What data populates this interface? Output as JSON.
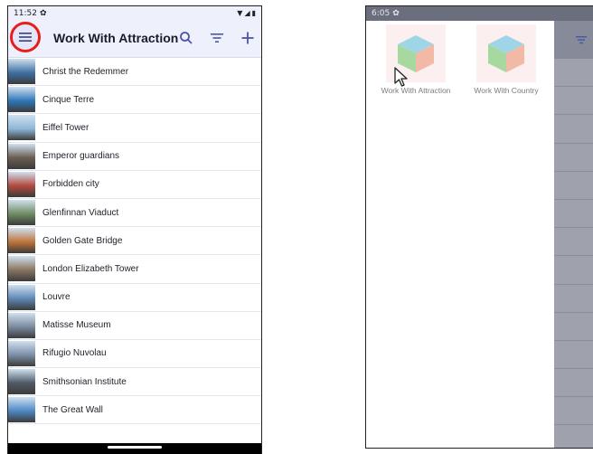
{
  "left": {
    "status": {
      "time": "11:52"
    },
    "appbar": {
      "title": "Work With Attraction"
    },
    "items": [
      {
        "label": "Christ the Redemmer",
        "color": "#3f6fa2"
      },
      {
        "label": "Cinque Terre",
        "color": "#2f77b8"
      },
      {
        "label": "Eiffel Tower",
        "color": "#8fb7d6"
      },
      {
        "label": "Emperor guardians",
        "color": "#6b5d52"
      },
      {
        "label": "Forbidden city",
        "color": "#b44a3d"
      },
      {
        "label": "Glenfinnan Viaduct",
        "color": "#6e8c62"
      },
      {
        "label": "Golden Gate Bridge",
        "color": "#c0743a"
      },
      {
        "label": "London Elizabeth Tower",
        "color": "#8a7660"
      },
      {
        "label": "Louvre",
        "color": "#5d86b5"
      },
      {
        "label": "Matisse Museum",
        "color": "#7a8b9e"
      },
      {
        "label": "Rifugio Nuvolau",
        "color": "#7d8ea8"
      },
      {
        "label": "Smithsonian Institute",
        "color": "#4f5a66"
      },
      {
        "label": "The Great Wall",
        "color": "#4d88c4"
      }
    ]
  },
  "right": {
    "status": {
      "time": "6:05"
    },
    "drawer": {
      "items": [
        {
          "label": "Work With Attraction"
        },
        {
          "label": "Work With Country"
        }
      ]
    }
  }
}
